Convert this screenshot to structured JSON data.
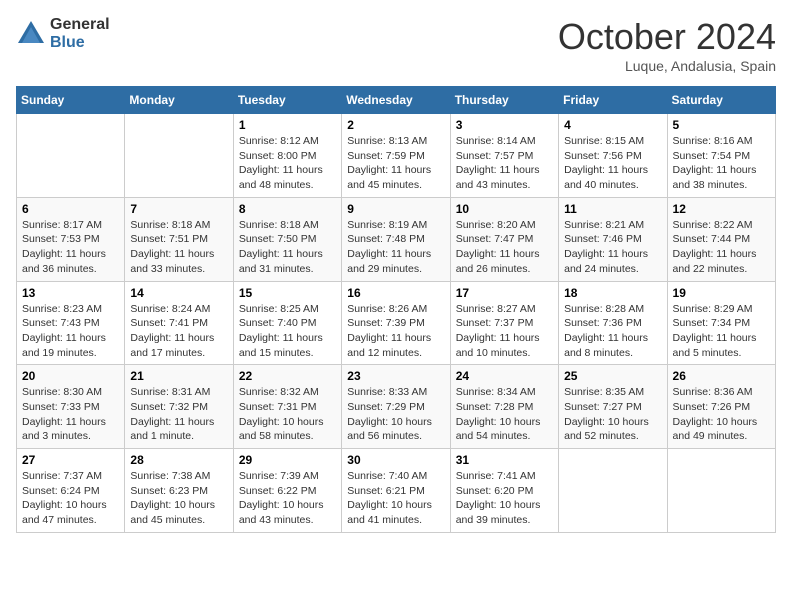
{
  "header": {
    "logo_general": "General",
    "logo_blue": "Blue",
    "month_title": "October 2024",
    "location": "Luque, Andalusia, Spain"
  },
  "days_of_week": [
    "Sunday",
    "Monday",
    "Tuesday",
    "Wednesday",
    "Thursday",
    "Friday",
    "Saturday"
  ],
  "weeks": [
    [
      {
        "day": "",
        "info": ""
      },
      {
        "day": "",
        "info": ""
      },
      {
        "day": "1",
        "info": "Sunrise: 8:12 AM\nSunset: 8:00 PM\nDaylight: 11 hours and 48 minutes."
      },
      {
        "day": "2",
        "info": "Sunrise: 8:13 AM\nSunset: 7:59 PM\nDaylight: 11 hours and 45 minutes."
      },
      {
        "day": "3",
        "info": "Sunrise: 8:14 AM\nSunset: 7:57 PM\nDaylight: 11 hours and 43 minutes."
      },
      {
        "day": "4",
        "info": "Sunrise: 8:15 AM\nSunset: 7:56 PM\nDaylight: 11 hours and 40 minutes."
      },
      {
        "day": "5",
        "info": "Sunrise: 8:16 AM\nSunset: 7:54 PM\nDaylight: 11 hours and 38 minutes."
      }
    ],
    [
      {
        "day": "6",
        "info": "Sunrise: 8:17 AM\nSunset: 7:53 PM\nDaylight: 11 hours and 36 minutes."
      },
      {
        "day": "7",
        "info": "Sunrise: 8:18 AM\nSunset: 7:51 PM\nDaylight: 11 hours and 33 minutes."
      },
      {
        "day": "8",
        "info": "Sunrise: 8:18 AM\nSunset: 7:50 PM\nDaylight: 11 hours and 31 minutes."
      },
      {
        "day": "9",
        "info": "Sunrise: 8:19 AM\nSunset: 7:48 PM\nDaylight: 11 hours and 29 minutes."
      },
      {
        "day": "10",
        "info": "Sunrise: 8:20 AM\nSunset: 7:47 PM\nDaylight: 11 hours and 26 minutes."
      },
      {
        "day": "11",
        "info": "Sunrise: 8:21 AM\nSunset: 7:46 PM\nDaylight: 11 hours and 24 minutes."
      },
      {
        "day": "12",
        "info": "Sunrise: 8:22 AM\nSunset: 7:44 PM\nDaylight: 11 hours and 22 minutes."
      }
    ],
    [
      {
        "day": "13",
        "info": "Sunrise: 8:23 AM\nSunset: 7:43 PM\nDaylight: 11 hours and 19 minutes."
      },
      {
        "day": "14",
        "info": "Sunrise: 8:24 AM\nSunset: 7:41 PM\nDaylight: 11 hours and 17 minutes."
      },
      {
        "day": "15",
        "info": "Sunrise: 8:25 AM\nSunset: 7:40 PM\nDaylight: 11 hours and 15 minutes."
      },
      {
        "day": "16",
        "info": "Sunrise: 8:26 AM\nSunset: 7:39 PM\nDaylight: 11 hours and 12 minutes."
      },
      {
        "day": "17",
        "info": "Sunrise: 8:27 AM\nSunset: 7:37 PM\nDaylight: 11 hours and 10 minutes."
      },
      {
        "day": "18",
        "info": "Sunrise: 8:28 AM\nSunset: 7:36 PM\nDaylight: 11 hours and 8 minutes."
      },
      {
        "day": "19",
        "info": "Sunrise: 8:29 AM\nSunset: 7:34 PM\nDaylight: 11 hours and 5 minutes."
      }
    ],
    [
      {
        "day": "20",
        "info": "Sunrise: 8:30 AM\nSunset: 7:33 PM\nDaylight: 11 hours and 3 minutes."
      },
      {
        "day": "21",
        "info": "Sunrise: 8:31 AM\nSunset: 7:32 PM\nDaylight: 11 hours and 1 minute."
      },
      {
        "day": "22",
        "info": "Sunrise: 8:32 AM\nSunset: 7:31 PM\nDaylight: 10 hours and 58 minutes."
      },
      {
        "day": "23",
        "info": "Sunrise: 8:33 AM\nSunset: 7:29 PM\nDaylight: 10 hours and 56 minutes."
      },
      {
        "day": "24",
        "info": "Sunrise: 8:34 AM\nSunset: 7:28 PM\nDaylight: 10 hours and 54 minutes."
      },
      {
        "day": "25",
        "info": "Sunrise: 8:35 AM\nSunset: 7:27 PM\nDaylight: 10 hours and 52 minutes."
      },
      {
        "day": "26",
        "info": "Sunrise: 8:36 AM\nSunset: 7:26 PM\nDaylight: 10 hours and 49 minutes."
      }
    ],
    [
      {
        "day": "27",
        "info": "Sunrise: 7:37 AM\nSunset: 6:24 PM\nDaylight: 10 hours and 47 minutes."
      },
      {
        "day": "28",
        "info": "Sunrise: 7:38 AM\nSunset: 6:23 PM\nDaylight: 10 hours and 45 minutes."
      },
      {
        "day": "29",
        "info": "Sunrise: 7:39 AM\nSunset: 6:22 PM\nDaylight: 10 hours and 43 minutes."
      },
      {
        "day": "30",
        "info": "Sunrise: 7:40 AM\nSunset: 6:21 PM\nDaylight: 10 hours and 41 minutes."
      },
      {
        "day": "31",
        "info": "Sunrise: 7:41 AM\nSunset: 6:20 PM\nDaylight: 10 hours and 39 minutes."
      },
      {
        "day": "",
        "info": ""
      },
      {
        "day": "",
        "info": ""
      }
    ]
  ]
}
